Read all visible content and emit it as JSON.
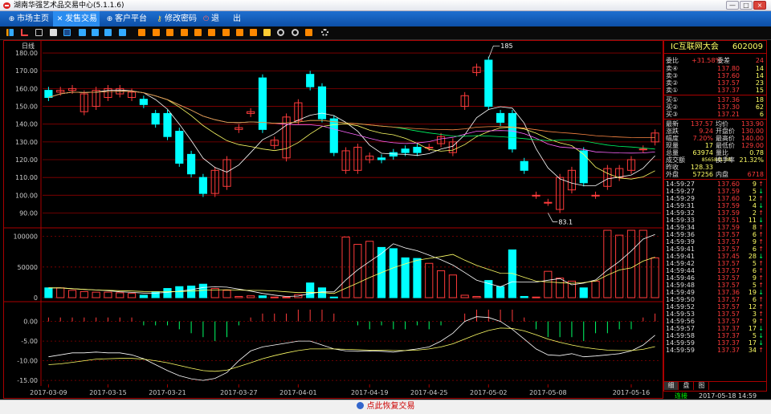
{
  "window": {
    "title": "湖南华强艺术品交易中心(5.1.1.6)",
    "minimize": "—",
    "restore": "□",
    "close": "×"
  },
  "nav": {
    "items": [
      {
        "label": "市场主页",
        "icon": "globe-icon",
        "active": false
      },
      {
        "label": "发售交易",
        "icon": "tools-icon",
        "active": true
      },
      {
        "label": "客户平台",
        "icon": "globe-icon",
        "active": false
      },
      {
        "label": "修改密码",
        "icon": "key-icon",
        "active": false
      },
      {
        "label": "退",
        "icon": "exit-icon",
        "active": false
      },
      {
        "label": "出",
        "icon": "",
        "active": false
      }
    ]
  },
  "chart": {
    "period_label": "日线",
    "price_ticks": [
      "180.00",
      "170.00",
      "160.00",
      "150.00",
      "140.00",
      "130.00",
      "120.00",
      "110.00",
      "100.00",
      "90.00"
    ],
    "volume_ticks": [
      "100000",
      "50000",
      "0"
    ],
    "macd_ticks": [
      "0.00",
      "-5.00",
      "-10.00",
      "-15.00"
    ],
    "date_labels": [
      "2017-03-09",
      "2017-03-15",
      "2017-03-21",
      "2017-03-27",
      "2017-04-01",
      "2017-04-19",
      "2017-04-25",
      "2017-05-02",
      "2017-05-08",
      "2017-05-16"
    ],
    "high_marker": "185",
    "low_marker": "83.1",
    "colors": {
      "up": "#ff3b3b",
      "down": "#00ffff",
      "grid": "#8b0000",
      "ma5": "#ffffff",
      "ma10": "#ffff66",
      "ma20": "#ff66ff",
      "ma30": "#00ff66",
      "ma60": "#ff8844"
    }
  },
  "chart_data": {
    "type": "candlestick",
    "price_ylim": [
      83,
      185
    ],
    "volume_ylim": [
      0,
      110000
    ],
    "macd_ylim": [
      -16,
      4
    ],
    "candles": [
      {
        "o": 159,
        "c": 155
      },
      {
        "o": 158,
        "c": 159
      },
      {
        "o": 159,
        "c": 160
      },
      {
        "o": 147,
        "c": 157
      },
      {
        "o": 150,
        "c": 159
      },
      {
        "o": 155,
        "c": 160
      },
      {
        "o": 157,
        "c": 160
      },
      {
        "o": 155,
        "c": 158
      },
      {
        "o": 154,
        "c": 151
      },
      {
        "o": 146,
        "c": 140
      },
      {
        "o": 146,
        "c": 133
      },
      {
        "o": 136,
        "c": 118
      },
      {
        "o": 123,
        "c": 112
      },
      {
        "o": 110,
        "c": 101
      },
      {
        "o": 101,
        "c": 114
      },
      {
        "o": 105,
        "c": 120
      },
      {
        "o": 137,
        "c": 138
      },
      {
        "o": 146,
        "c": 147
      },
      {
        "o": 166,
        "c": 137
      },
      {
        "o": 128,
        "c": 131
      },
      {
        "o": 121,
        "c": 144
      },
      {
        "o": 142,
        "c": 152
      },
      {
        "o": 168,
        "c": 161
      },
      {
        "o": 161,
        "c": 143
      },
      {
        "o": 143,
        "c": 124
      },
      {
        "o": 114,
        "c": 125
      },
      {
        "o": 114,
        "c": 127
      },
      {
        "o": 120,
        "c": 122
      },
      {
        "o": 121,
        "c": 120
      },
      {
        "o": 124,
        "c": 122
      },
      {
        "o": 126,
        "c": 124
      },
      {
        "o": 127,
        "c": 124
      },
      {
        "o": 127,
        "c": 127
      },
      {
        "o": 129,
        "c": 133
      },
      {
        "o": 124,
        "c": 130
      },
      {
        "o": 150,
        "c": 156
      },
      {
        "o": 169,
        "c": 172
      },
      {
        "o": 176,
        "c": 150
      },
      {
        "o": 146,
        "c": 141
      },
      {
        "o": 146,
        "c": 126
      },
      {
        "o": 119,
        "c": 114
      },
      {
        "o": 100,
        "c": 100
      },
      {
        "o": 96,
        "c": 96
      },
      {
        "o": 92,
        "c": 110
      },
      {
        "o": 103,
        "c": 114
      },
      {
        "o": 125,
        "c": 107
      },
      {
        "o": 100,
        "c": 100
      },
      {
        "o": 105,
        "c": 115
      },
      {
        "o": 110,
        "c": 115
      },
      {
        "o": 114,
        "c": 120
      },
      {
        "o": 126,
        "c": 126
      },
      {
        "o": 130,
        "c": 135
      }
    ],
    "volumes": [
      16000,
      16000,
      12000,
      10000,
      9000,
      9000,
      8000,
      7000,
      4000,
      9000,
      15000,
      18000,
      19000,
      22000,
      15000,
      12000,
      2000,
      3000,
      3000,
      1000,
      1000,
      5000,
      24000,
      16000,
      1000,
      99000,
      87000,
      92000,
      82000,
      80000,
      65000,
      64000,
      56000,
      44000,
      37000,
      4000,
      2000,
      28000,
      18000,
      78000,
      2000,
      1000,
      43000,
      32000,
      27000,
      16000,
      27000,
      124000,
      102000,
      112000,
      113000,
      65000
    ],
    "macd_bars": [
      1,
      1,
      1,
      1,
      1,
      1,
      1,
      1,
      -1,
      -1,
      -1,
      -2,
      -3,
      -4,
      -5,
      -4,
      -1,
      1,
      2,
      2,
      2,
      3,
      3,
      3,
      2,
      0,
      -1,
      -2,
      -1,
      -2,
      -2,
      -1,
      -2,
      -1,
      0,
      2,
      3,
      3,
      3,
      3,
      1,
      -2,
      -4,
      -4,
      -4,
      -5,
      -3,
      -3,
      -2,
      -2,
      1,
      2
    ],
    "dif": [
      -9,
      -8.5,
      -8,
      -8,
      -7.8,
      -8,
      -8,
      -8.5,
      -9.5,
      -11,
      -12.5,
      -13.8,
      -14.6,
      -15,
      -14.5,
      -13,
      -10,
      -7.5,
      -6.5,
      -6,
      -5.5,
      -5,
      -5,
      -6,
      -7,
      -7.5,
      -7.6,
      -7.5,
      -7.6,
      -7.8,
      -7.4,
      -7,
      -6.5,
      -5,
      -3,
      0,
      1.2,
      1,
      0,
      -2,
      -4.5,
      -7,
      -8.5,
      -8.7,
      -8.2,
      -9,
      -8.8,
      -8.5,
      -8.2,
      -7.5,
      -6,
      -3.5
    ],
    "dea": [
      -11,
      -10.8,
      -10.4,
      -10,
      -9.6,
      -9.5,
      -9.4,
      -9.4,
      -9.6,
      -10,
      -10.5,
      -11.2,
      -11.9,
      -12.5,
      -12.7,
      -12.4,
      -11.5,
      -10.5,
      -9.5,
      -8.7,
      -8,
      -7.4,
      -7,
      -7,
      -7,
      -7.1,
      -7.2,
      -7.3,
      -7.3,
      -7.4,
      -7.4,
      -7.3,
      -7,
      -6.5,
      -5.7,
      -4.5,
      -3.3,
      -2.3,
      -1.7,
      -1.8,
      -2.4,
      -3.4,
      -4.5,
      -5.3,
      -6,
      -6.6,
      -7,
      -7.3,
      -7.4,
      -7.4,
      -7.1,
      -6.4
    ]
  },
  "quote": {
    "name": "IC互联网大会",
    "code": "602009",
    "weibi_label": "委比",
    "weibi": "+31.58%",
    "weicha_label": "委差",
    "weicha": "24",
    "asks": [
      {
        "label": "卖④",
        "price": "137.80",
        "qty": "14"
      },
      {
        "label": "卖③",
        "price": "137.60",
        "qty": "14"
      },
      {
        "label": "卖②",
        "price": "137.57",
        "qty": "23"
      },
      {
        "label": "卖①",
        "price": "137.37",
        "qty": "15"
      }
    ],
    "bids": [
      {
        "label": "买①",
        "price": "137.36",
        "qty": "18"
      },
      {
        "label": "买②",
        "price": "137.30",
        "qty": "62"
      },
      {
        "label": "买③",
        "price": "137.21",
        "qty": "6"
      }
    ],
    "stats": [
      {
        "l1": "最新",
        "v1": "137.57",
        "l2": "均价",
        "v2": "133.90"
      },
      {
        "l1": "涨跌",
        "v1": "9.24",
        "l2": "开盘价",
        "v2": "130.00"
      },
      {
        "l1": "幅度",
        "v1": "7.20%",
        "l2": "最高价",
        "v2": "140.00"
      },
      {
        "l1": "现量",
        "v1": "17",
        "l2": "最低价",
        "v2": "129.00"
      },
      {
        "l1": "总量",
        "v1": "63974",
        "l2": "量比",
        "v2": "0.78"
      },
      {
        "l1": "成交额",
        "v1": "8565841.38",
        "l2": "换手率",
        "v2": "21.32%"
      },
      {
        "l1": "昨收",
        "v1": "128.33",
        "l2": "",
        "v2": ""
      },
      {
        "l1": "外盘",
        "v1": "57256",
        "l2": "内盘",
        "v2": "6718"
      }
    ],
    "ticks": [
      {
        "t": "14:59:27",
        "p": "137.60",
        "q": "9",
        "d": "up"
      },
      {
        "t": "14:59:27",
        "p": "137.59",
        "q": "5",
        "d": "down"
      },
      {
        "t": "14:59:29",
        "p": "137.60",
        "q": "12",
        "d": "up"
      },
      {
        "t": "14:59:31",
        "p": "137.59",
        "q": "4",
        "d": "down"
      },
      {
        "t": "14:59:32",
        "p": "137.59",
        "q": "2",
        "d": "up"
      },
      {
        "t": "14:59:33",
        "p": "137.51",
        "q": "11",
        "d": "down"
      },
      {
        "t": "14:59:34",
        "p": "137.59",
        "q": "8",
        "d": "up"
      },
      {
        "t": "14:59:36",
        "p": "137.57",
        "q": "6",
        "d": "up"
      },
      {
        "t": "14:59:39",
        "p": "137.57",
        "q": "9",
        "d": "up"
      },
      {
        "t": "14:59:41",
        "p": "137.57",
        "q": "6",
        "d": "up"
      },
      {
        "t": "14:59:41",
        "p": "137.45",
        "q": "28",
        "d": "down"
      },
      {
        "t": "14:59:42",
        "p": "137.57",
        "q": "5",
        "d": "up"
      },
      {
        "t": "14:59:44",
        "p": "137.57",
        "q": "6",
        "d": "up"
      },
      {
        "t": "14:59:46",
        "p": "137.57",
        "q": "9",
        "d": "up"
      },
      {
        "t": "14:59:48",
        "p": "137.57",
        "q": "5",
        "d": "up"
      },
      {
        "t": "14:59:49",
        "p": "137.36",
        "q": "19",
        "d": "down"
      },
      {
        "t": "14:59:50",
        "p": "137.57",
        "q": "6",
        "d": "up"
      },
      {
        "t": "14:59:52",
        "p": "137.57",
        "q": "12",
        "d": "up"
      },
      {
        "t": "14:59:53",
        "p": "137.57",
        "q": "3",
        "d": "up"
      },
      {
        "t": "14:59:56",
        "p": "137.57",
        "q": "9",
        "d": "up"
      },
      {
        "t": "14:59:57",
        "p": "137.37",
        "q": "17",
        "d": "down"
      },
      {
        "t": "14:59:58",
        "p": "137.37",
        "q": "5",
        "d": "down"
      },
      {
        "t": "14:59:59",
        "p": "137.37",
        "q": "17",
        "d": "down"
      },
      {
        "t": "14:59:59",
        "p": "137.37",
        "q": "34",
        "d": "up"
      }
    ],
    "tabs": [
      "细",
      "盘",
      "图"
    ]
  },
  "status": {
    "conn": "连接",
    "datetime": "2017-05-18 14:59"
  },
  "bottom": {
    "label": "点此恢复交易"
  }
}
